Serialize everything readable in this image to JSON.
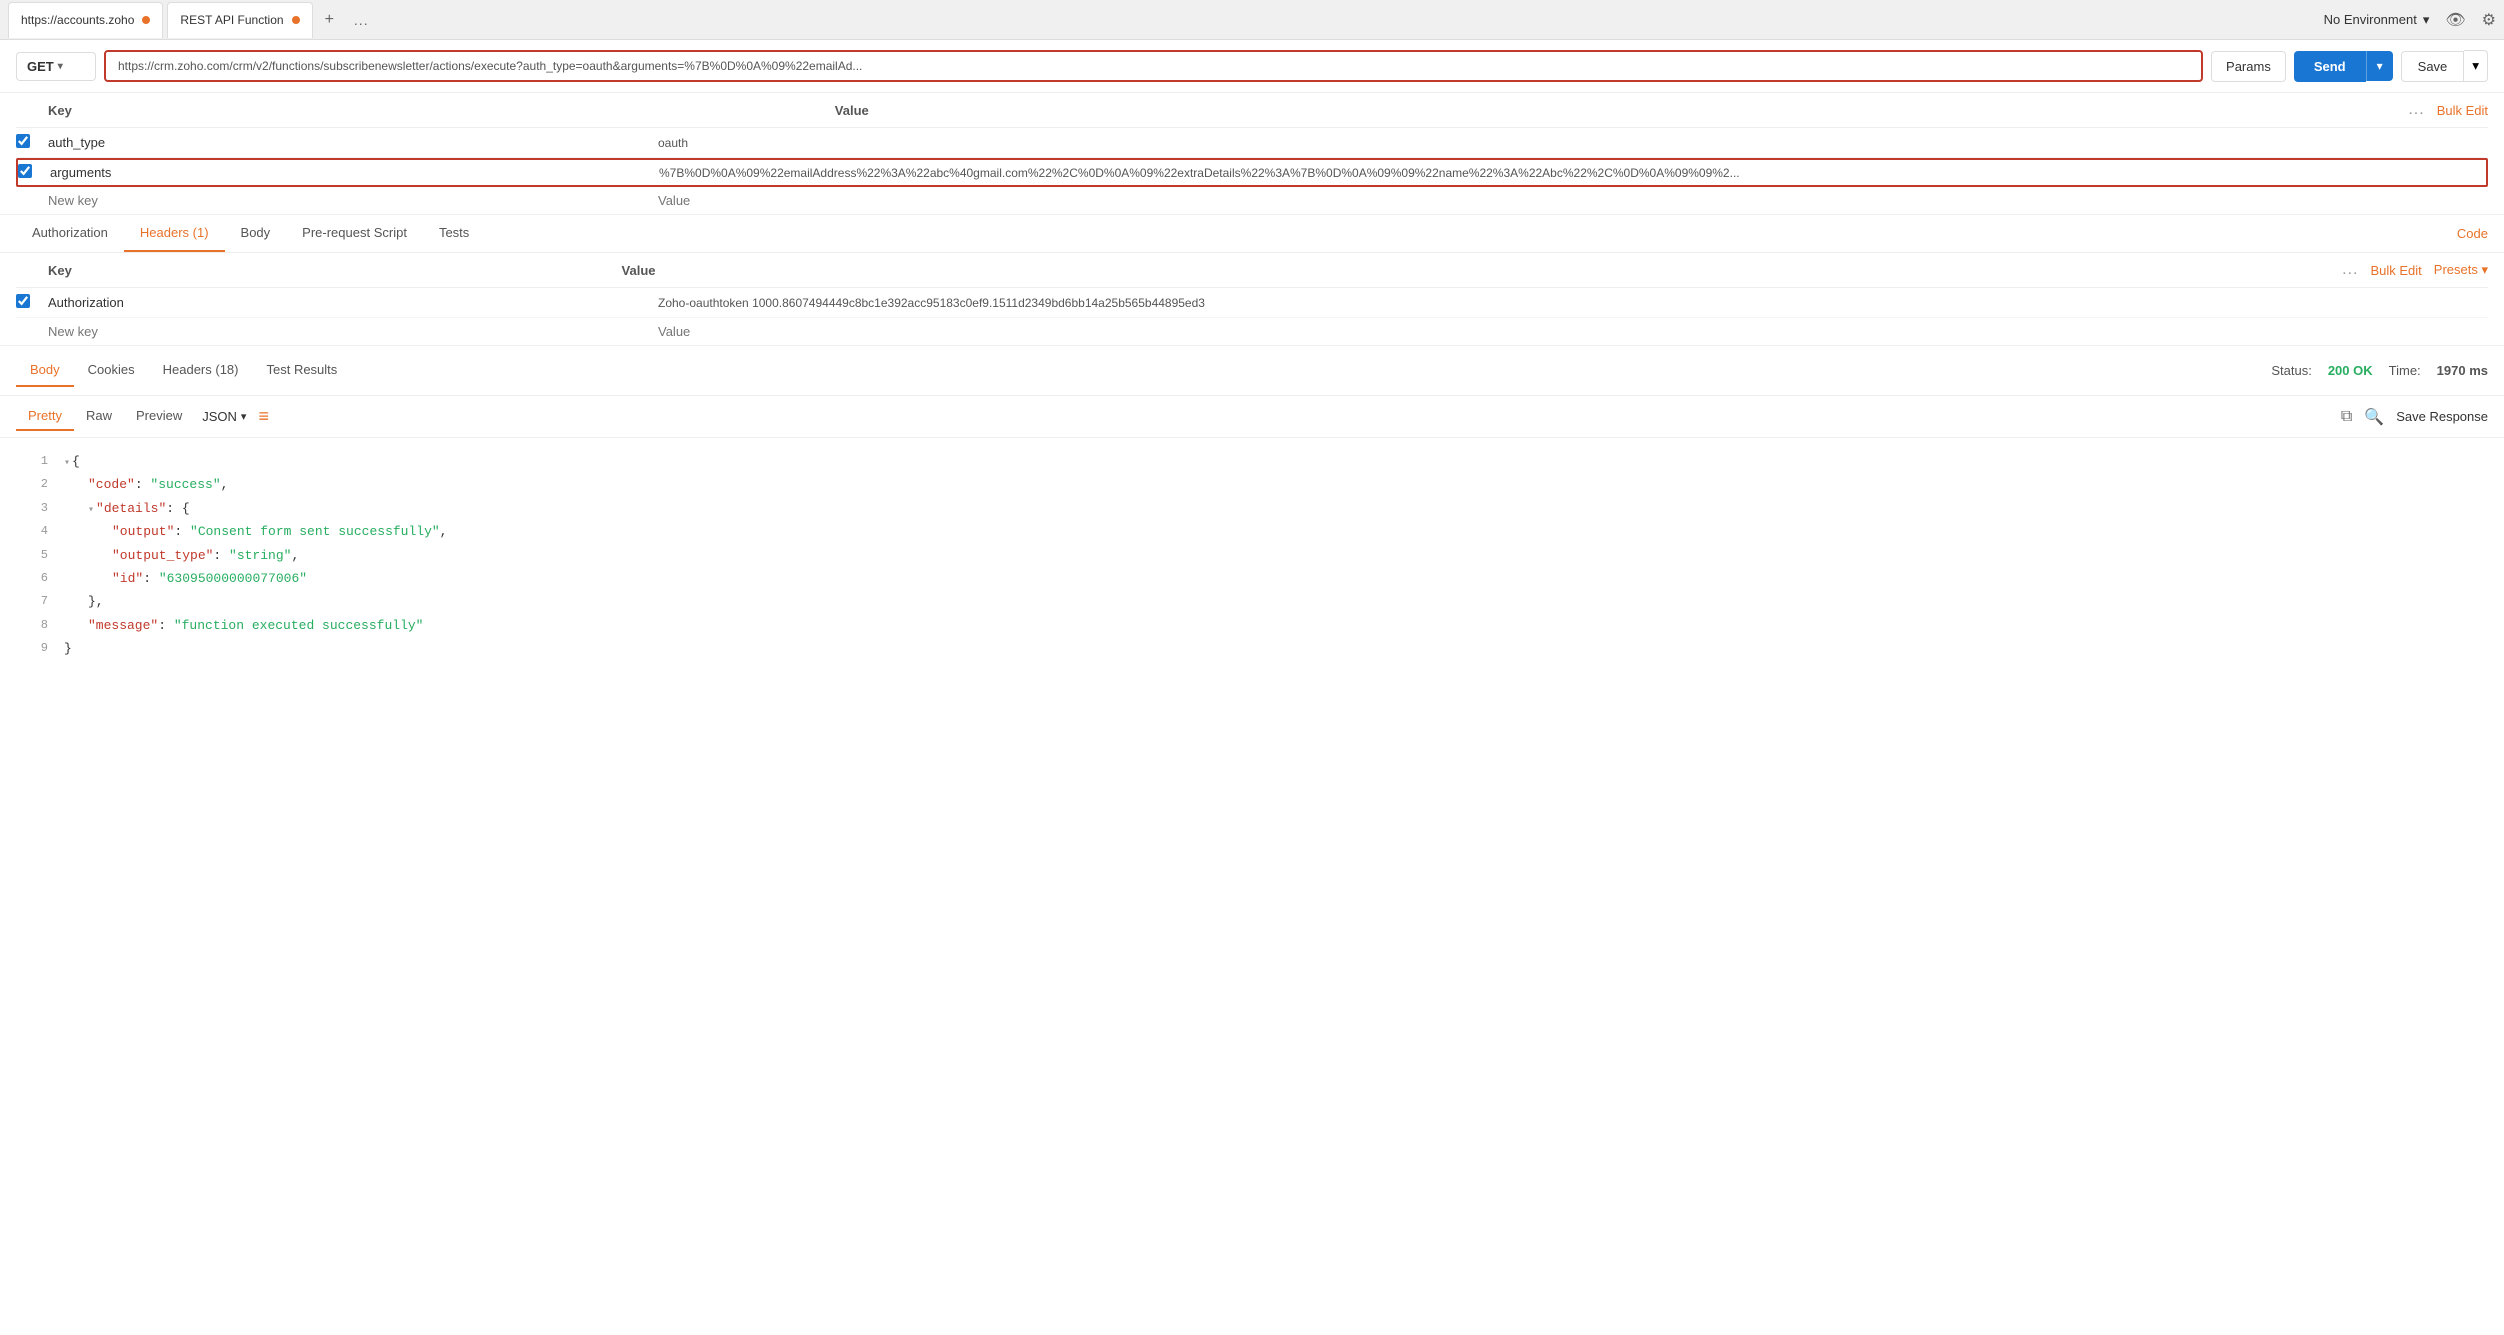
{
  "tabs": {
    "tab1": {
      "label": "https://accounts.zoho",
      "dot": true
    },
    "tab2": {
      "label": "REST API Function",
      "dot": true
    },
    "add": "+",
    "more": "..."
  },
  "env": {
    "label": "No Environment",
    "eye_icon": "👁",
    "gear_icon": "⚙"
  },
  "url_bar": {
    "method": "GET",
    "url": "https://crm.zoho.com/crm/v2/functions/subscribenewsletter/actions/execute?auth_type=oauth&arguments=%7B%0D%0A%09%22emailAd...",
    "params_label": "Params",
    "send_label": "Send",
    "save_label": "Save"
  },
  "params": {
    "col_key": "Key",
    "col_value": "Value",
    "more_label": "...",
    "bulk_edit_label": "Bulk Edit",
    "rows": [
      {
        "checked": true,
        "key": "auth_type",
        "value": "oauth"
      },
      {
        "checked": true,
        "key": "arguments",
        "value": "%7B%0D%0A%09%22emailAddress%22%3A%22abc%40gmail.com%22%2C%0D%0A%09%22extraDetails%22%3A%7B%0D%0A%09%09%22name%22%3A%22Abc%22%2C%0D%0A%09%09%2..."
      }
    ],
    "new_key_placeholder": "New key",
    "new_val_placeholder": "Value"
  },
  "request_tabs": {
    "tabs": [
      "Authorization",
      "Headers (1)",
      "Body",
      "Pre-request Script",
      "Tests"
    ],
    "active": "Headers (1)",
    "code_label": "Code"
  },
  "headers": {
    "col_key": "Key",
    "col_value": "Value",
    "more_label": "...",
    "bulk_edit_label": "Bulk Edit",
    "presets_label": "Presets ▾",
    "rows": [
      {
        "checked": true,
        "key": "Authorization",
        "value": "Zoho-oauthtoken 1000.8607494449c8bc1e392acc95183c0ef9.1511d2349bd6bb14a25b565b44895ed3"
      }
    ],
    "new_key_placeholder": "New key",
    "new_val_placeholder": "Value"
  },
  "response": {
    "tabs": [
      "Body",
      "Cookies",
      "Headers (18)",
      "Test Results"
    ],
    "active": "Body",
    "status_label": "Status:",
    "status_value": "200 OK",
    "time_label": "Time:",
    "time_value": "1970 ms",
    "format_tabs": [
      "Pretty",
      "Raw",
      "Preview"
    ],
    "active_format": "Pretty",
    "format_type": "JSON",
    "save_response_label": "Save Response"
  },
  "json_output": {
    "lines": [
      {
        "num": "1",
        "indent": 0,
        "fold": "▾",
        "content": "{"
      },
      {
        "num": "2",
        "indent": 1,
        "fold": "",
        "content": "\"code\": \"success\","
      },
      {
        "num": "3",
        "indent": 1,
        "fold": "▾",
        "content": "\"details\": {"
      },
      {
        "num": "4",
        "indent": 2,
        "fold": "",
        "content": "\"output\": \"Consent form sent successfully\","
      },
      {
        "num": "5",
        "indent": 2,
        "fold": "",
        "content": "\"output_type\": \"string\","
      },
      {
        "num": "6",
        "indent": 2,
        "fold": "",
        "content": "\"id\": \"63095000000077006\""
      },
      {
        "num": "7",
        "indent": 1,
        "fold": "",
        "content": "},"
      },
      {
        "num": "8",
        "indent": 1,
        "fold": "",
        "content": "\"message\": \"function executed successfully\""
      },
      {
        "num": "9",
        "indent": 0,
        "fold": "",
        "content": "}"
      }
    ]
  }
}
